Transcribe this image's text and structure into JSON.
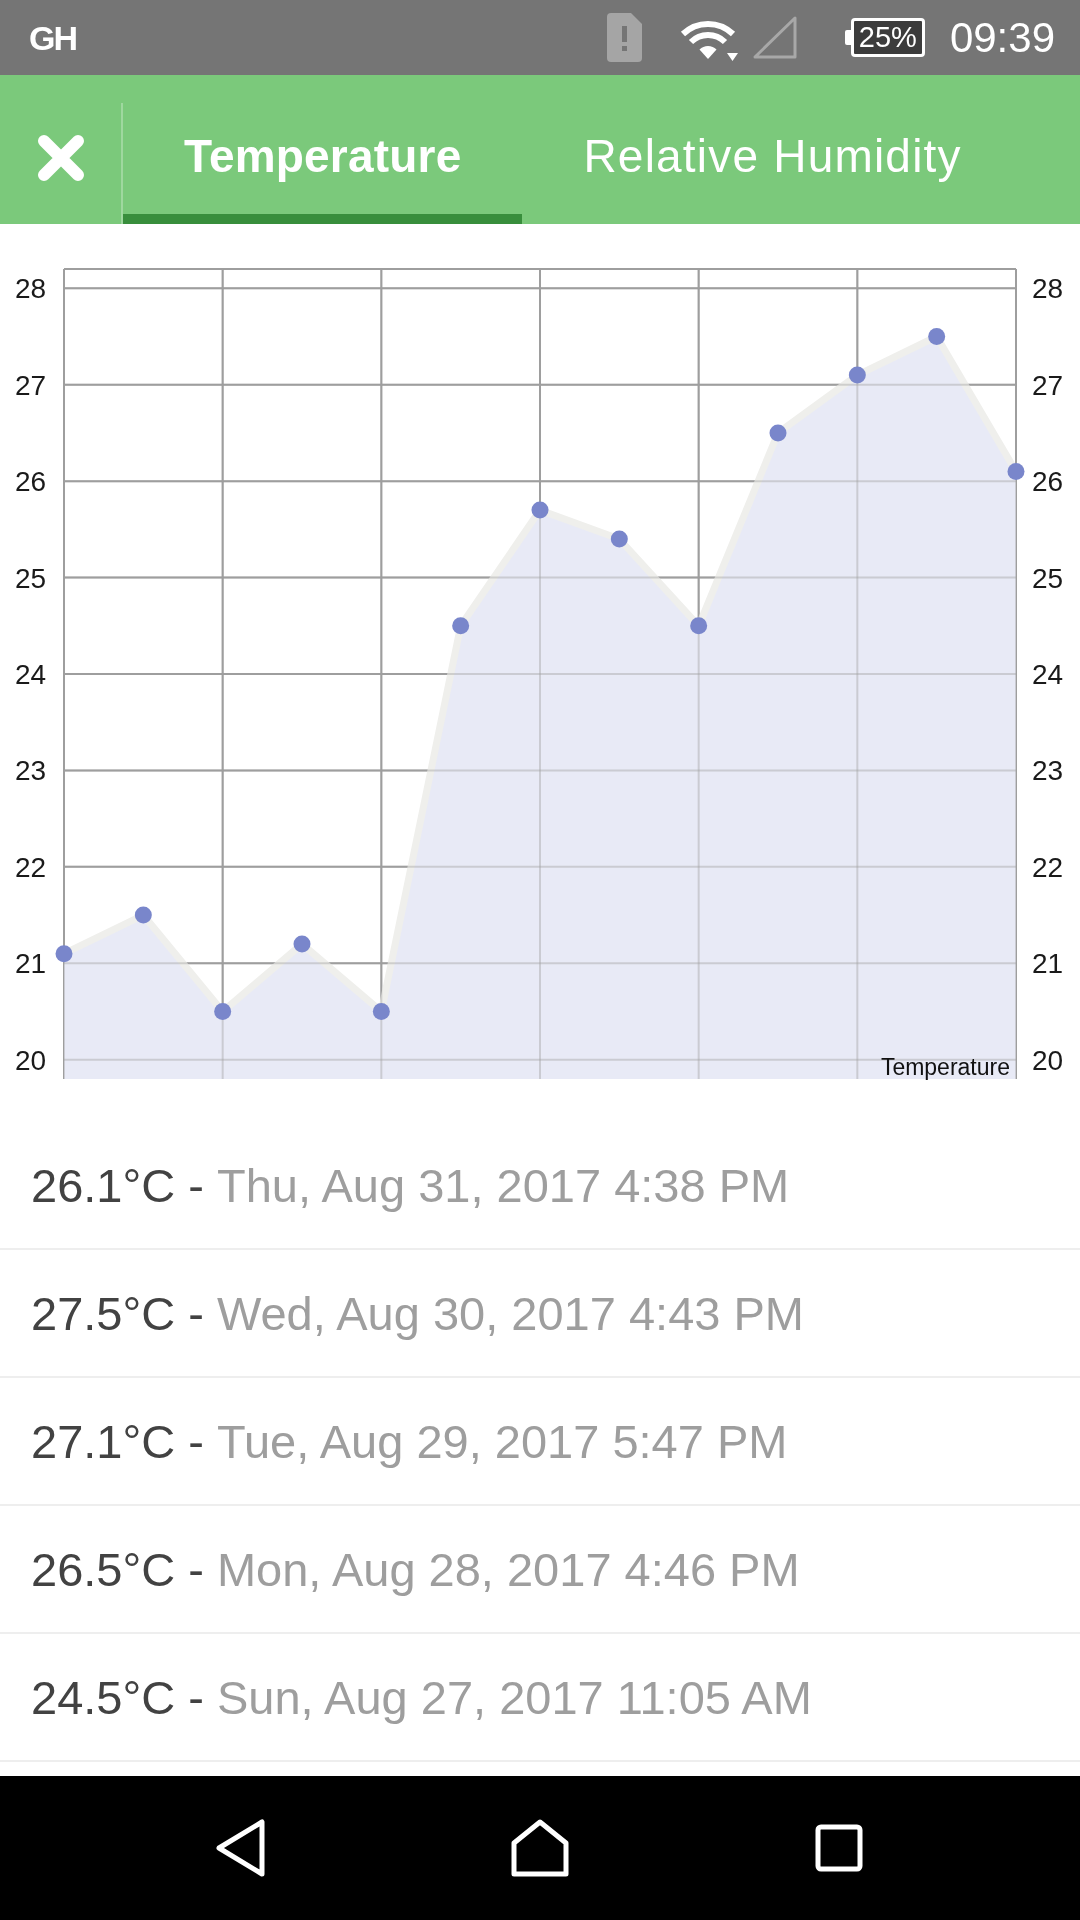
{
  "status_bar": {
    "app_icon": "GH",
    "battery": "25%",
    "time": "09:39"
  },
  "tabs": [
    {
      "label": "Temperature",
      "selected": true
    },
    {
      "label": "Relative Humidity",
      "selected": false
    }
  ],
  "chart": {
    "chart_data": {
      "type": "area",
      "series": [
        {
          "name": "Temperature",
          "color": "#7986cb",
          "values": [
            21.1,
            21.5,
            20.5,
            21.2,
            20.5,
            24.5,
            25.7,
            25.4,
            24.5,
            26.5,
            27.1,
            27.5,
            26.1
          ]
        }
      ],
      "ylim": [
        19.8,
        28.2
      ],
      "yticks": [
        20,
        21,
        22,
        23,
        24,
        25,
        26,
        27,
        28
      ],
      "grid": true
    },
    "right_axis_labels": [
      "28",
      "27",
      "26",
      "25",
      "24",
      "23",
      "22",
      "21",
      "20"
    ]
  },
  "readings": [
    {
      "value": "26.1°C -",
      "time": "Thu, Aug 31, 2017 4:38 PM"
    },
    {
      "value": "27.5°C -",
      "time": "Wed, Aug 30, 2017 4:43 PM"
    },
    {
      "value": "27.1°C -",
      "time": "Tue, Aug 29, 2017 5:47 PM"
    },
    {
      "value": "26.5°C -",
      "time": "Mon, Aug 28, 2017 4:46 PM"
    },
    {
      "value": "24.5°C -",
      "time": "Sun, Aug 27, 2017 11:05 AM"
    }
  ]
}
